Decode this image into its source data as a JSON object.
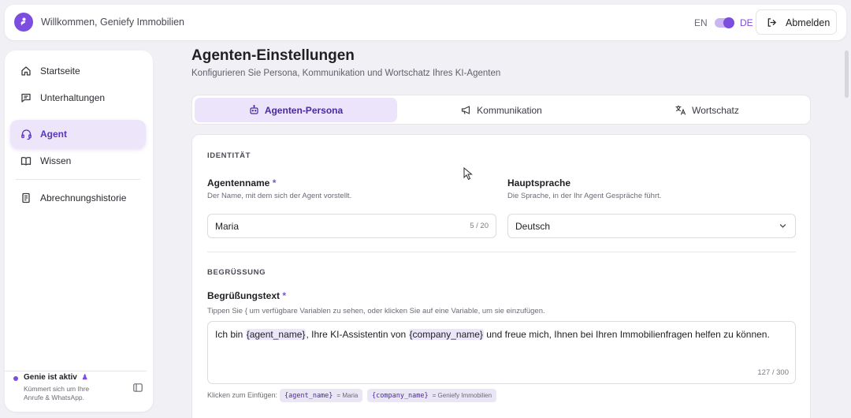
{
  "header": {
    "welcome": "Willkommen, Geniefy Immobilien",
    "lang_en": "EN",
    "lang_de": "DE",
    "logout_label": "Abmelden",
    "accent": "#7c4ddf"
  },
  "sidebar": {
    "items": [
      {
        "label": "Startseite",
        "icon": "home-icon"
      },
      {
        "label": "Unterhaltungen",
        "icon": "chat-icon"
      },
      {
        "label": "Agent",
        "icon": "headset-icon",
        "active": true
      },
      {
        "label": "Wissen",
        "icon": "book-icon"
      },
      {
        "label": "Abrechnungshistorie",
        "icon": "receipt-icon"
      }
    ],
    "status_title": "Genie ist aktiv",
    "status_sub": "Kümmert sich um Ihre Anrufe & WhatsApp."
  },
  "page": {
    "title": "Agenten-Einstellungen",
    "subtitle": "Konfigurieren Sie Persona, Kommunikation und Wortschatz Ihres KI-Agenten"
  },
  "tabs": [
    {
      "label": "Agenten-Persona",
      "icon": "robot-icon",
      "active": true
    },
    {
      "label": "Kommunikation",
      "icon": "megaphone-icon"
    },
    {
      "label": "Wortschatz",
      "icon": "translate-icon"
    }
  ],
  "identity": {
    "section": "IDENTITÄT",
    "name_label": "Agentenname",
    "required_mark": "*",
    "name_hint": "Der Name, mit dem sich der Agent vorstellt.",
    "name_value": "Maria",
    "name_counter": "5 / 20",
    "lang_label": "Hauptsprache",
    "lang_hint": "Die Sprache, in der Ihr Agent Gespräche führt.",
    "lang_value": "Deutsch"
  },
  "greeting": {
    "section": "BEGRÜSSUNG",
    "label": "Begrüßungstext",
    "hint": "Tippen Sie { um verfügbare Variablen zu sehen, oder klicken Sie auf eine Variable, um sie einzufügen.",
    "text_part1": "Ich bin ",
    "var1": "{agent_name}",
    "text_part2": ", Ihre KI-Assistentin von ",
    "var2": "{company_name}",
    "text_part3": " und freue mich, Ihnen bei Ihren Immobilienfragen helfen zu können.",
    "counter": "127 / 300",
    "chips_label": "Klicken zum Einfügen:",
    "chips": [
      {
        "code": "{agent_name}",
        "value": "= Maria"
      },
      {
        "code": "{company_name}",
        "value": "= Geniefy Immobilien"
      }
    ]
  }
}
